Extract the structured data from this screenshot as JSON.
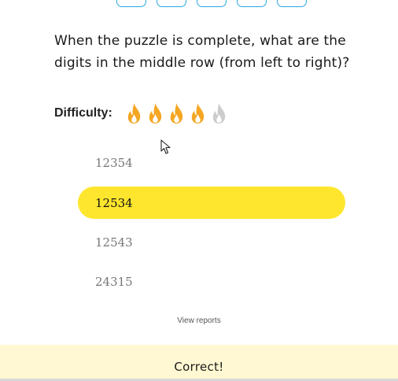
{
  "puzzle": {
    "grid_boxes": 5
  },
  "question": {
    "text": "When the puzzle is complete, what are the digits in the middle row (from left to right)?"
  },
  "difficulty": {
    "label": "Difficulty:",
    "rating": 4,
    "max": 5,
    "icon": "flame-icon",
    "active_color": "#f5a623",
    "inactive_color": "#cccccc"
  },
  "choices": [
    {
      "label": "12354",
      "selected": false
    },
    {
      "label": "12534",
      "selected": true
    },
    {
      "label": "12543",
      "selected": false
    },
    {
      "label": "24315",
      "selected": false
    }
  ],
  "links": {
    "view_reports": "View reports"
  },
  "result": {
    "text": "Correct!",
    "background_color": "#fff8d2"
  },
  "colors": {
    "selected_choice": "#ffe62e",
    "grid_box_border": "#29a8df"
  }
}
